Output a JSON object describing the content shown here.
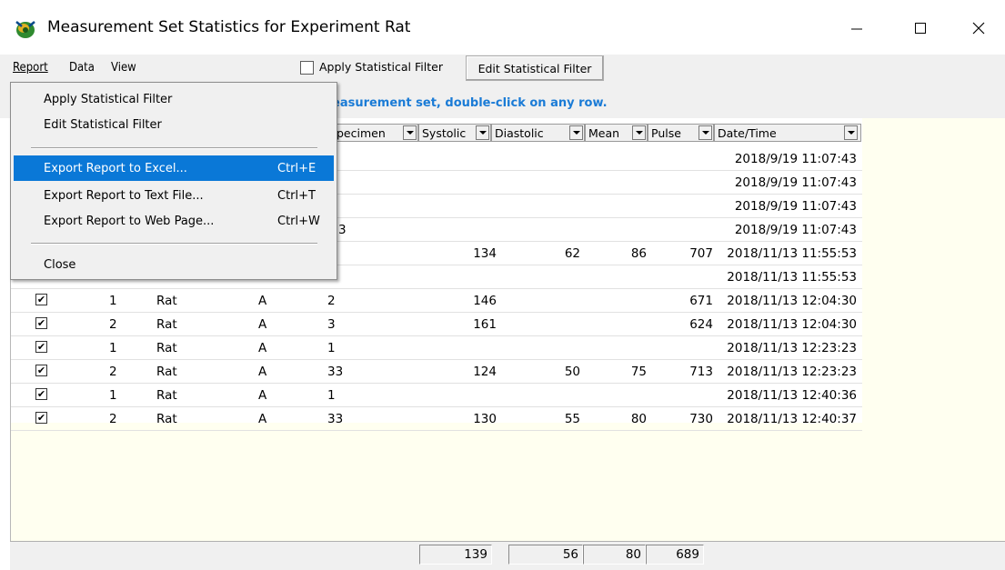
{
  "window": {
    "title": "Measurement Set Statistics for Experiment Rat",
    "icon": "app-icon"
  },
  "menubar": {
    "report": "Report",
    "data": "Data",
    "view": "View"
  },
  "toolbar": {
    "apply_filter_label": "Apply Statistical Filter",
    "apply_filter_checked": false,
    "edit_filter_label": "Edit Statistical Filter"
  },
  "hint": "easurement set, double-click on any row.",
  "report_menu": {
    "items": [
      {
        "label": "Apply Statistical Filter",
        "shortcut": ""
      },
      {
        "label": "Edit Statistical Filter",
        "shortcut": ""
      },
      {
        "label": "Export Report to Excel...",
        "shortcut": "Ctrl+E"
      },
      {
        "label": "Export Report to Text File...",
        "shortcut": "Ctrl+T"
      },
      {
        "label": "Export Report to Web Page...",
        "shortcut": "Ctrl+W"
      },
      {
        "label": "Close",
        "shortcut": ""
      }
    ],
    "selected_index": 2
  },
  "table": {
    "headers": [
      "pecimen",
      "Systolic",
      "Diastolic",
      "Mean",
      "Pulse",
      "Date/Time"
    ],
    "rows": [
      {
        "checked": null,
        "n": "",
        "animal": "",
        "group": "",
        "specimen": "",
        "systolic": "",
        "diastolic": "",
        "mean": "",
        "pulse": "",
        "datetime": "2018/9/19 11:07:43"
      },
      {
        "checked": null,
        "n": "",
        "animal": "",
        "group": "",
        "specimen": "",
        "systolic": "",
        "diastolic": "",
        "mean": "",
        "pulse": "",
        "datetime": "2018/9/19 11:07:43"
      },
      {
        "checked": null,
        "n": "",
        "animal": "",
        "group": "",
        "specimen": "",
        "systolic": "",
        "diastolic": "",
        "mean": "",
        "pulse": "",
        "datetime": "2018/9/19 11:07:43"
      },
      {
        "checked": null,
        "n": "",
        "animal": "",
        "group": "",
        "specimen": "3",
        "systolic": "",
        "diastolic": "",
        "mean": "",
        "pulse": "",
        "datetime": "2018/9/19 11:07:43"
      },
      {
        "checked": null,
        "n": "",
        "animal": "",
        "group": "",
        "specimen": "",
        "systolic": "134",
        "diastolic": "62",
        "mean": "86",
        "pulse": "707",
        "datetime": "2018/11/13 11:55:53"
      },
      {
        "checked": null,
        "n": "",
        "animal": "",
        "group": "",
        "specimen": "",
        "systolic": "",
        "diastolic": "",
        "mean": "",
        "pulse": "",
        "datetime": "2018/11/13 11:55:53"
      },
      {
        "checked": true,
        "n": "1",
        "animal": "Rat",
        "group": "A",
        "specimen": "2",
        "systolic": "146",
        "diastolic": "",
        "mean": "",
        "pulse": "671",
        "datetime": "2018/11/13 12:04:30"
      },
      {
        "checked": true,
        "n": "2",
        "animal": "Rat",
        "group": "A",
        "specimen": "3",
        "systolic": "161",
        "diastolic": "",
        "mean": "",
        "pulse": "624",
        "datetime": "2018/11/13 12:04:30"
      },
      {
        "checked": true,
        "n": "1",
        "animal": "Rat",
        "group": "A",
        "specimen": "1",
        "systolic": "",
        "diastolic": "",
        "mean": "",
        "pulse": "",
        "datetime": "2018/11/13 12:23:23"
      },
      {
        "checked": true,
        "n": "2",
        "animal": "Rat",
        "group": "A",
        "specimen": "33",
        "systolic": "124",
        "diastolic": "50",
        "mean": "75",
        "pulse": "713",
        "datetime": "2018/11/13 12:23:23"
      },
      {
        "checked": true,
        "n": "1",
        "animal": "Rat",
        "group": "A",
        "specimen": "1",
        "systolic": "",
        "diastolic": "",
        "mean": "",
        "pulse": "",
        "datetime": "2018/11/13 12:40:36"
      },
      {
        "checked": true,
        "n": "2",
        "animal": "Rat",
        "group": "A",
        "specimen": "33",
        "systolic": "130",
        "diastolic": "55",
        "mean": "80",
        "pulse": "730",
        "datetime": "2018/11/13 12:40:37"
      }
    ]
  },
  "totals": {
    "systolic": "139",
    "diastolic": "56",
    "mean": "80",
    "pulse": "689"
  },
  "colors": {
    "accent": "#0a78d7",
    "hint": "#1a7bd6",
    "grid_bg": "#fffff0"
  }
}
